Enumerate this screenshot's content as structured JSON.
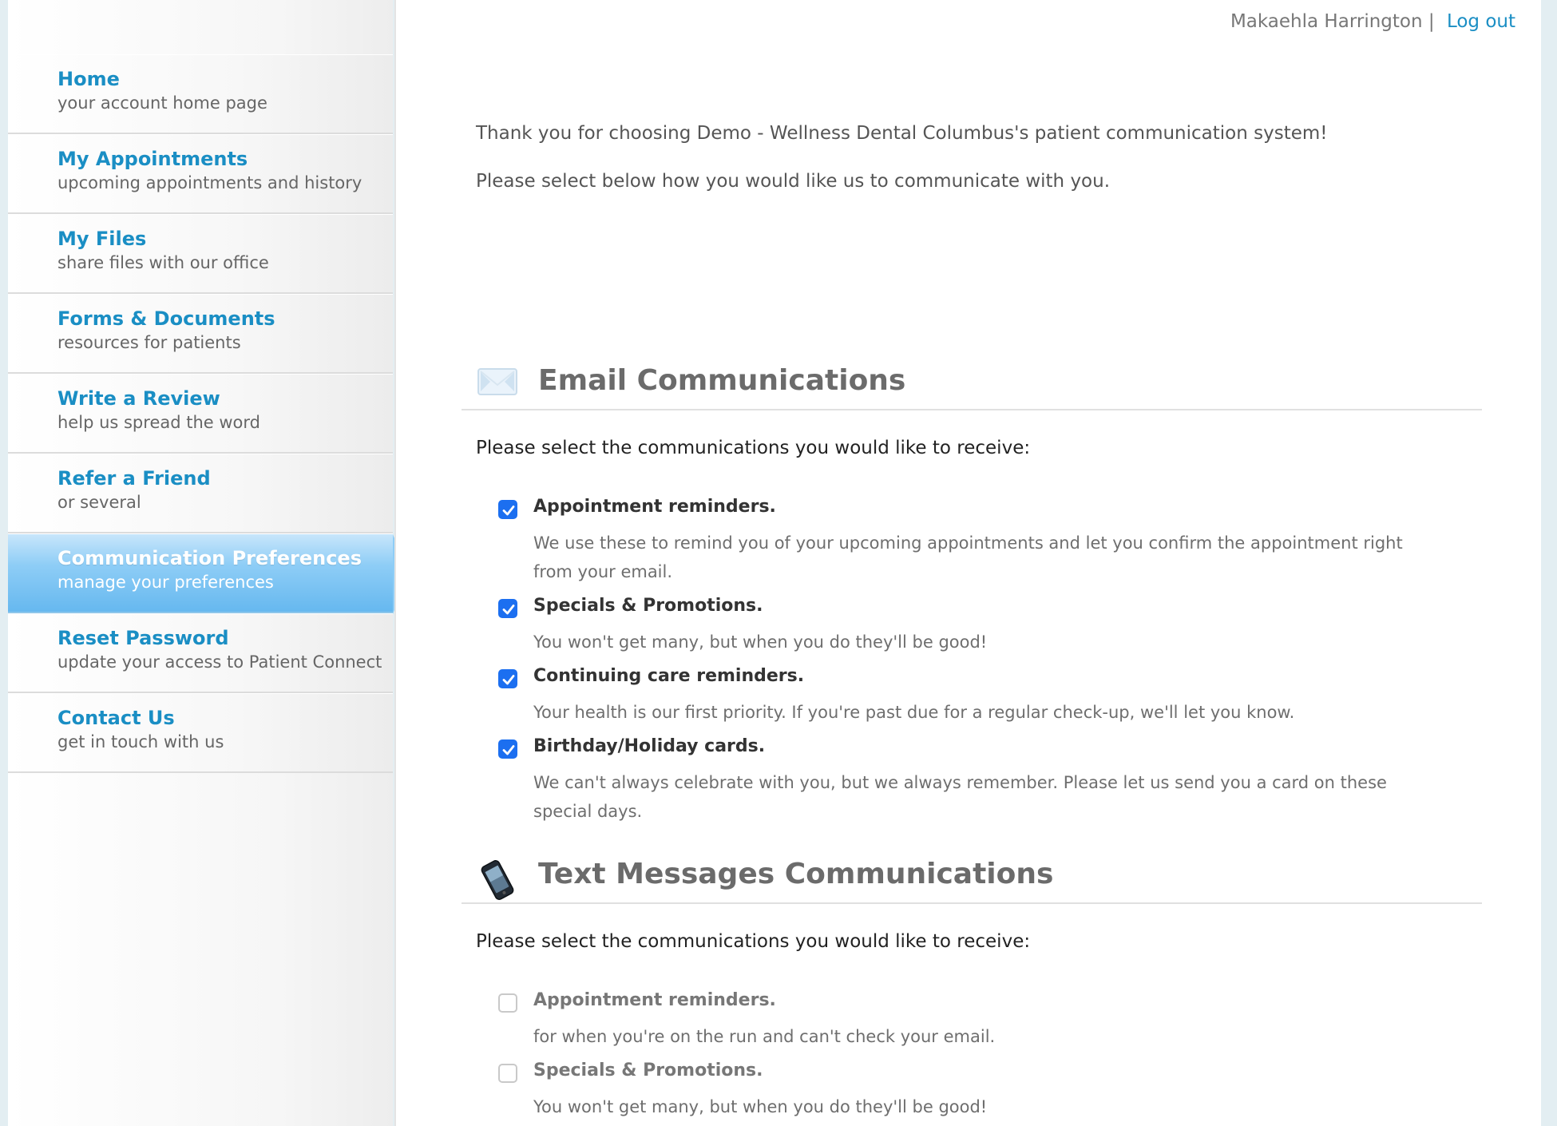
{
  "user": {
    "name": "Makaehla Harrington",
    "separator": "|",
    "logout_label": "Log out"
  },
  "sidebar": {
    "items": [
      {
        "title": "Home",
        "subtitle": "your account home page"
      },
      {
        "title": "My Appointments",
        "subtitle": "upcoming appointments and history"
      },
      {
        "title": "My Files",
        "subtitle": "share files with our office"
      },
      {
        "title": "Forms & Documents",
        "subtitle": "resources for patients"
      },
      {
        "title": "Write a Review",
        "subtitle": "help us spread the word"
      },
      {
        "title": "Refer a Friend",
        "subtitle": "or several"
      },
      {
        "title": "Communication Preferences",
        "subtitle": "manage your preferences"
      },
      {
        "title": "Reset Password",
        "subtitle": "update your access to Patient Connect"
      },
      {
        "title": "Contact Us",
        "subtitle": "get in touch with us"
      }
    ],
    "active_index": 6
  },
  "intro": {
    "line1": "Thank you for choosing Demo - Wellness Dental Columbus's patient communication system!",
    "line2": "Please select below how you would like us to communicate with you."
  },
  "email": {
    "title": "Email Communications",
    "prompt": "Please select the communications you would like to receive:",
    "options": [
      {
        "label": "Appointment reminders.",
        "desc": "We use these to remind you of your upcoming appointments and let you confirm the appointment right from your email.",
        "checked": true
      },
      {
        "label": "Specials & Promotions.",
        "desc": "You won't get many, but when you do they'll be good!",
        "checked": true
      },
      {
        "label": "Continuing care reminders.",
        "desc": "Your health is our first priority. If you're past due for a regular check-up, we'll let you know.",
        "checked": true
      },
      {
        "label": "Birthday/Holiday cards.",
        "desc": "We can't always celebrate with you, but we always remember. Please let us send you a card on these special days.",
        "checked": true
      }
    ]
  },
  "text": {
    "title": "Text Messages Communications",
    "prompt": "Please select the communications you would like to receive:",
    "options": [
      {
        "label": "Appointment reminders.",
        "desc": "for when you're on the run and can't check your email.",
        "checked": false
      },
      {
        "label": "Specials & Promotions.",
        "desc": "You won't get many, but when you do they'll be good!",
        "checked": false
      }
    ]
  },
  "icons": {
    "email": "envelope-icon",
    "text": "phone-icon"
  },
  "colors": {
    "link": "#1a8ec4",
    "active_nav": "#8ecdf6",
    "checkbox": "#1c6ff0"
  }
}
